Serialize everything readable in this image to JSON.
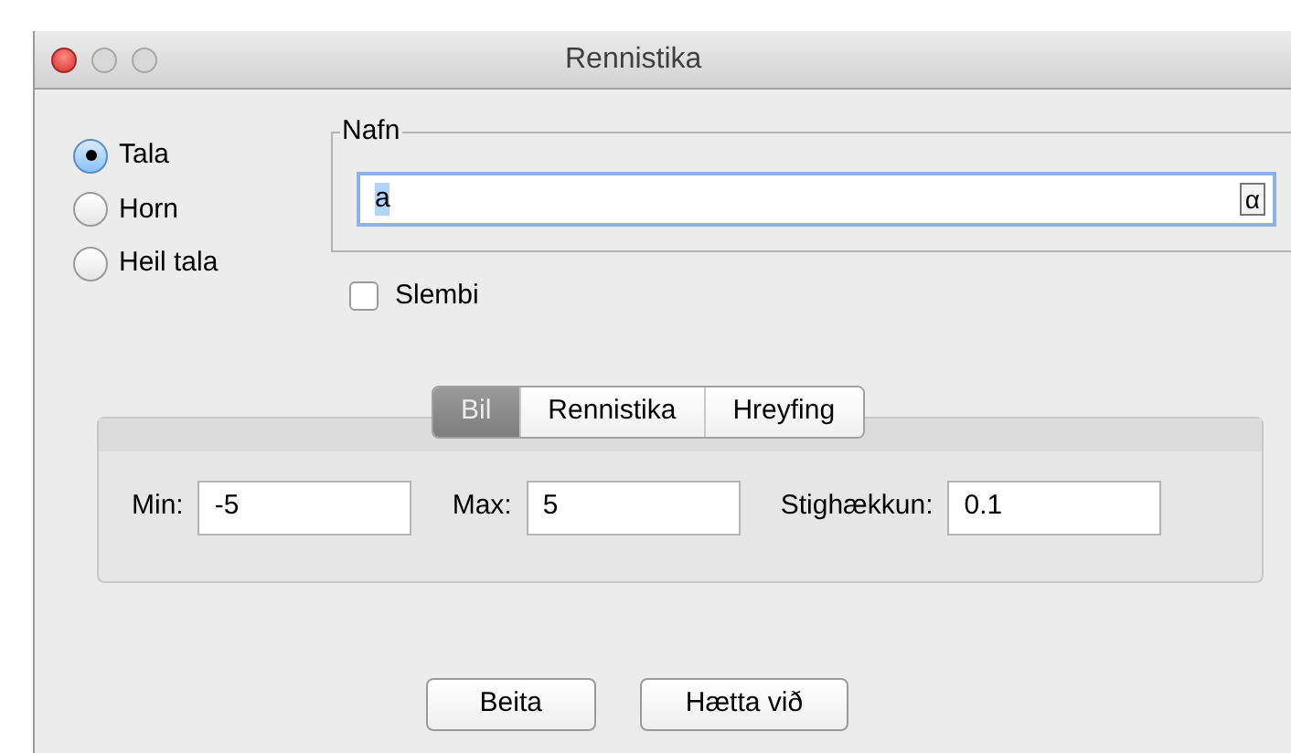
{
  "window": {
    "title": "Rennistika"
  },
  "type_options": [
    {
      "label": "Tala",
      "selected": true
    },
    {
      "label": "Horn",
      "selected": false
    },
    {
      "label": "Heil tala",
      "selected": false
    }
  ],
  "name_group": {
    "title": "Nafn",
    "value": "a",
    "symbol_button": "α"
  },
  "random": {
    "label": "Slembi",
    "checked": false
  },
  "tabs": [
    {
      "label": "Bil",
      "selected": true
    },
    {
      "label": "Rennistika",
      "selected": false
    },
    {
      "label": "Hreyfing",
      "selected": false
    }
  ],
  "fields": [
    {
      "label": "Min:",
      "value": "-5"
    },
    {
      "label": "Max:",
      "value": "5"
    },
    {
      "label": "Stighækkun:",
      "value": "0.1"
    }
  ],
  "buttons": [
    "Beita",
    "Hætta við"
  ]
}
